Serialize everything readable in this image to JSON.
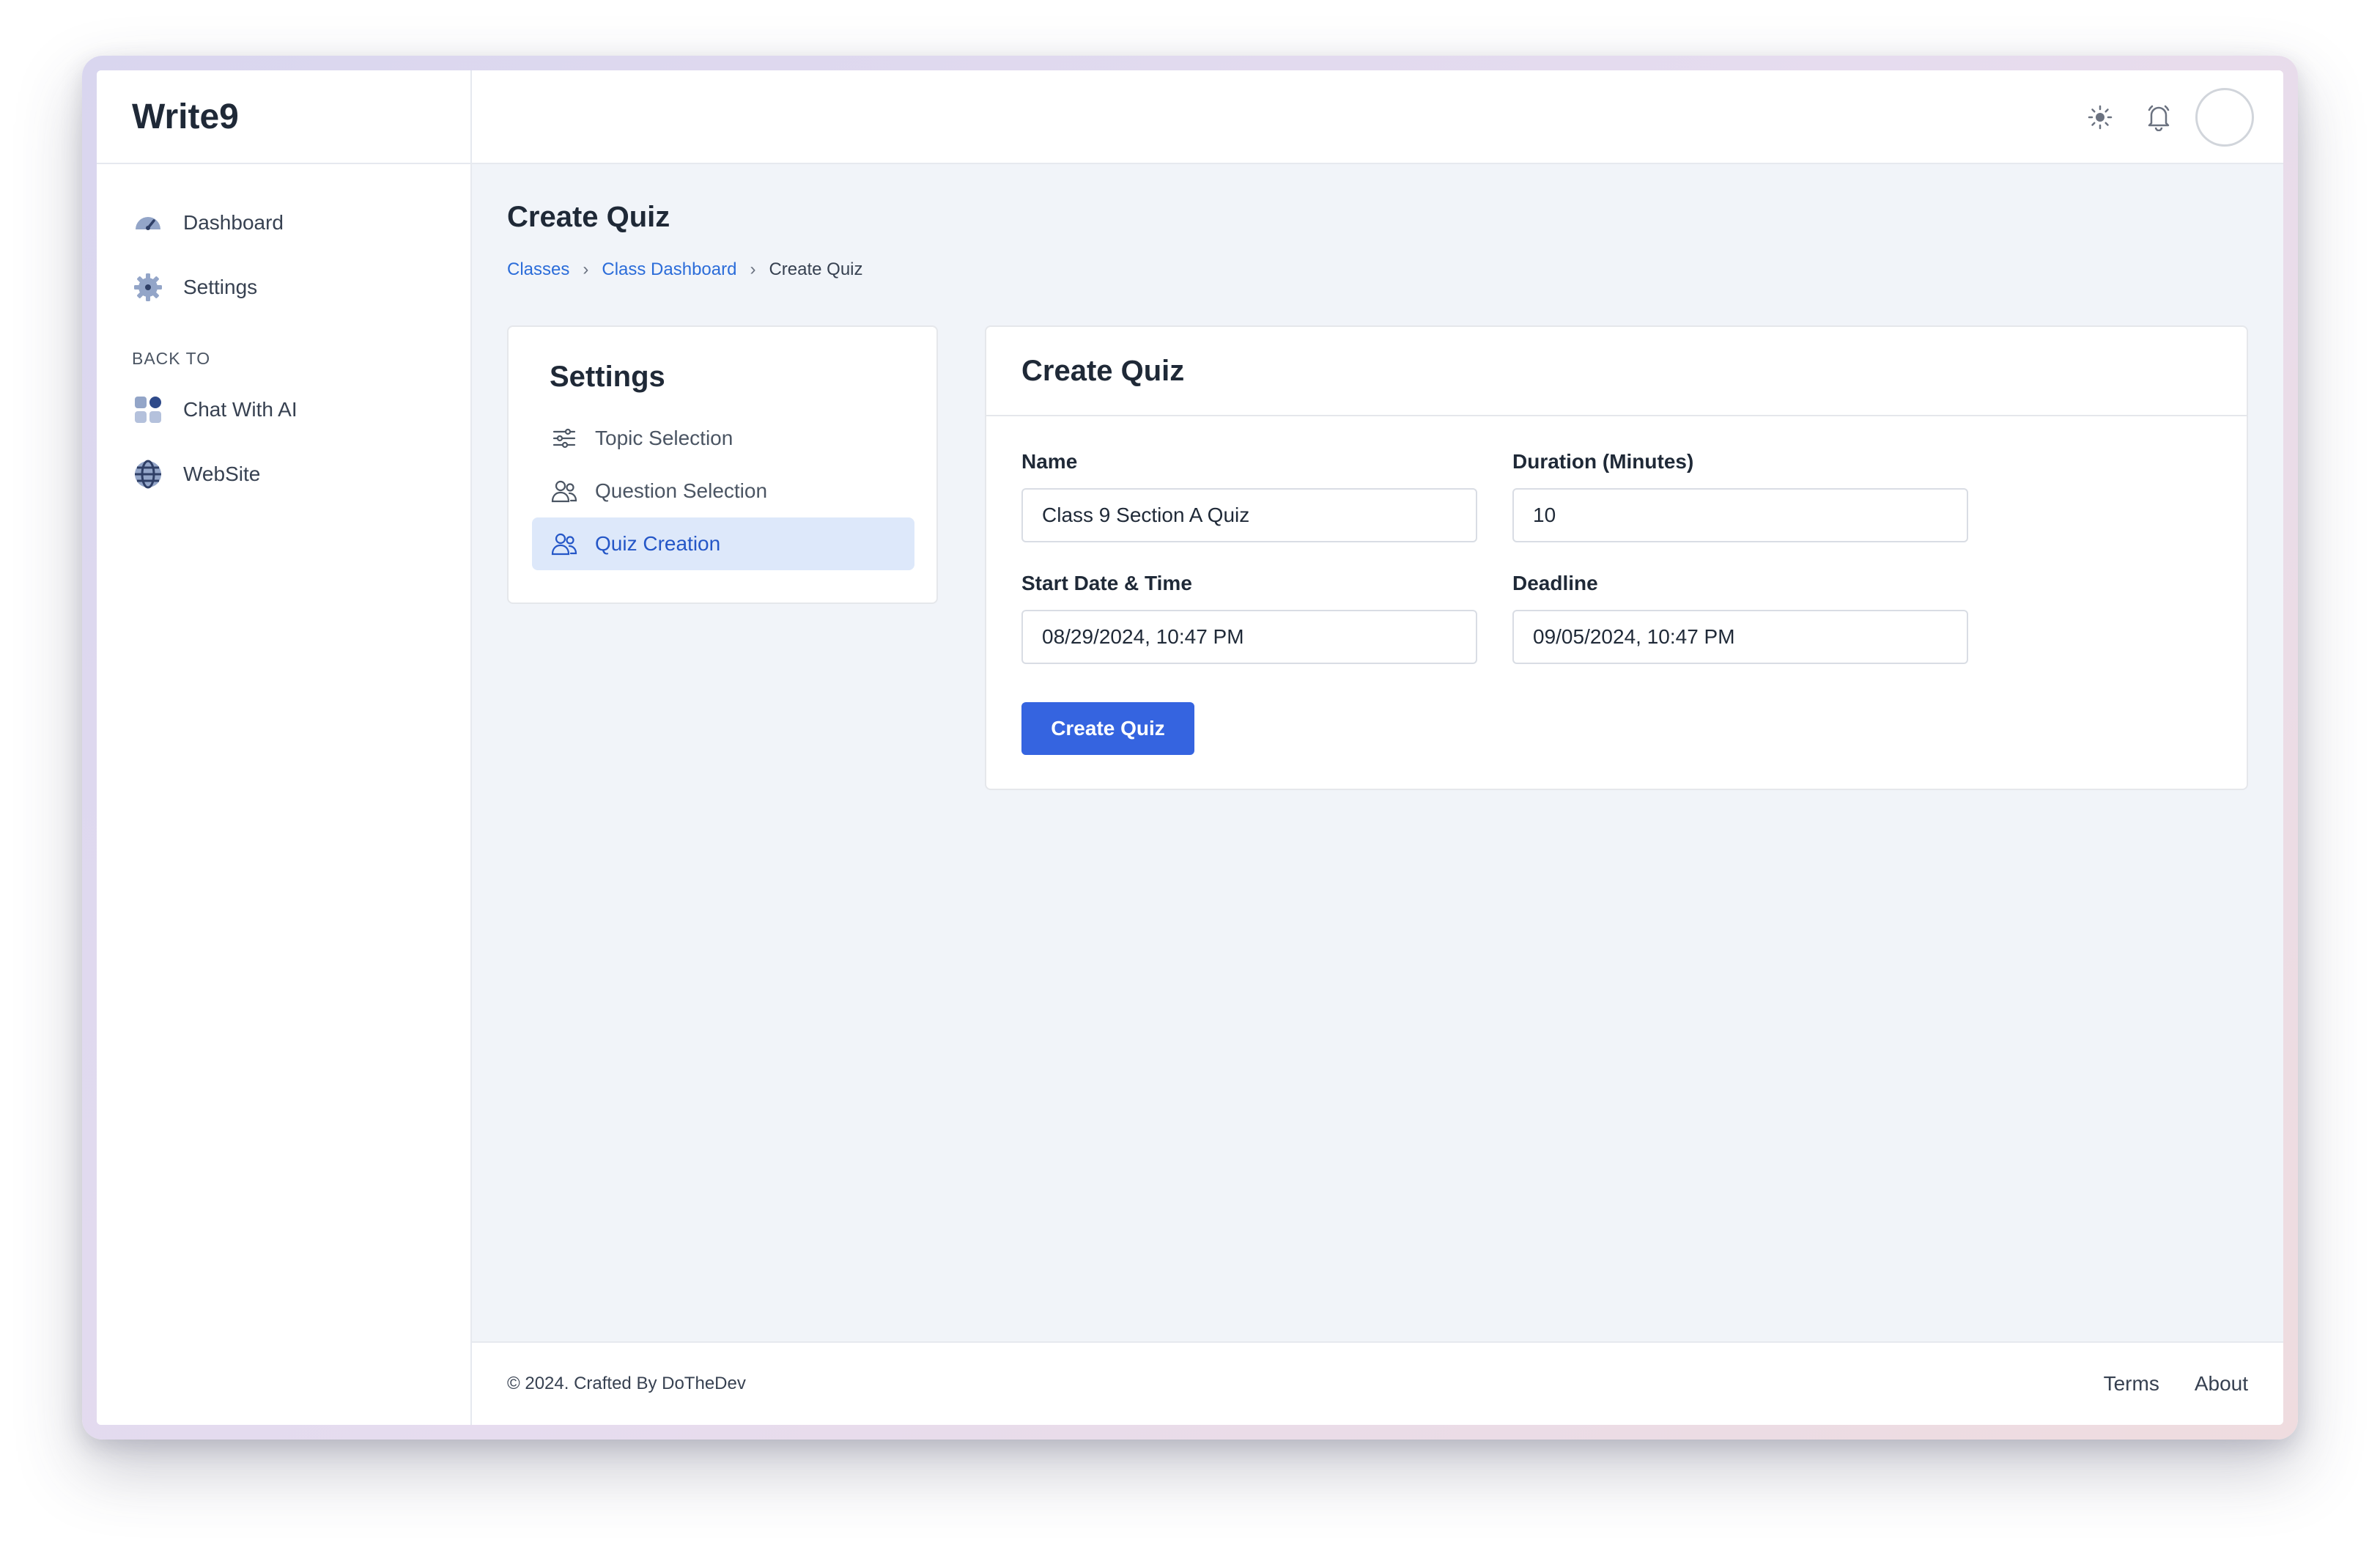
{
  "app": {
    "brand": "Write9"
  },
  "sidebar": {
    "items": [
      {
        "label": "Dashboard",
        "icon": "dashboard-gauge-icon"
      },
      {
        "label": "Settings",
        "icon": "gear-icon"
      }
    ],
    "section_label": "BACK TO",
    "back_items": [
      {
        "label": "Chat With AI",
        "icon": "grid-apps-icon"
      },
      {
        "label": "WebSite",
        "icon": "globe-icon"
      }
    ]
  },
  "topbar": {
    "icons": [
      "sun-icon",
      "bell-icon",
      "avatar"
    ]
  },
  "page": {
    "title": "Create Quiz",
    "breadcrumb": [
      "Classes",
      "Class Dashboard",
      "Create Quiz"
    ]
  },
  "settings_panel": {
    "title": "Settings",
    "items": [
      {
        "label": "Topic Selection",
        "icon": "sliders-icon"
      },
      {
        "label": "Question Selection",
        "icon": "users-icon"
      },
      {
        "label": "Quiz Creation",
        "icon": "users-icon",
        "active": true
      }
    ]
  },
  "form": {
    "title": "Create Quiz",
    "name": {
      "label": "Name",
      "value": "Class 9 Section A Quiz"
    },
    "duration": {
      "label": "Duration (Minutes)",
      "value": "10"
    },
    "start": {
      "label": "Start Date & Time",
      "value": "08/29/2024, 10:47 PM"
    },
    "deadline": {
      "label": "Deadline",
      "value": "09/05/2024, 10:47 PM"
    },
    "submit_label": "Create Quiz"
  },
  "footer": {
    "copyright": "© 2024. Crafted By DoTheDev",
    "links": [
      "Terms",
      "About"
    ]
  },
  "colors": {
    "accent": "#3564e0",
    "link": "#2b6cd9",
    "active_bg": "#dde8fa"
  }
}
